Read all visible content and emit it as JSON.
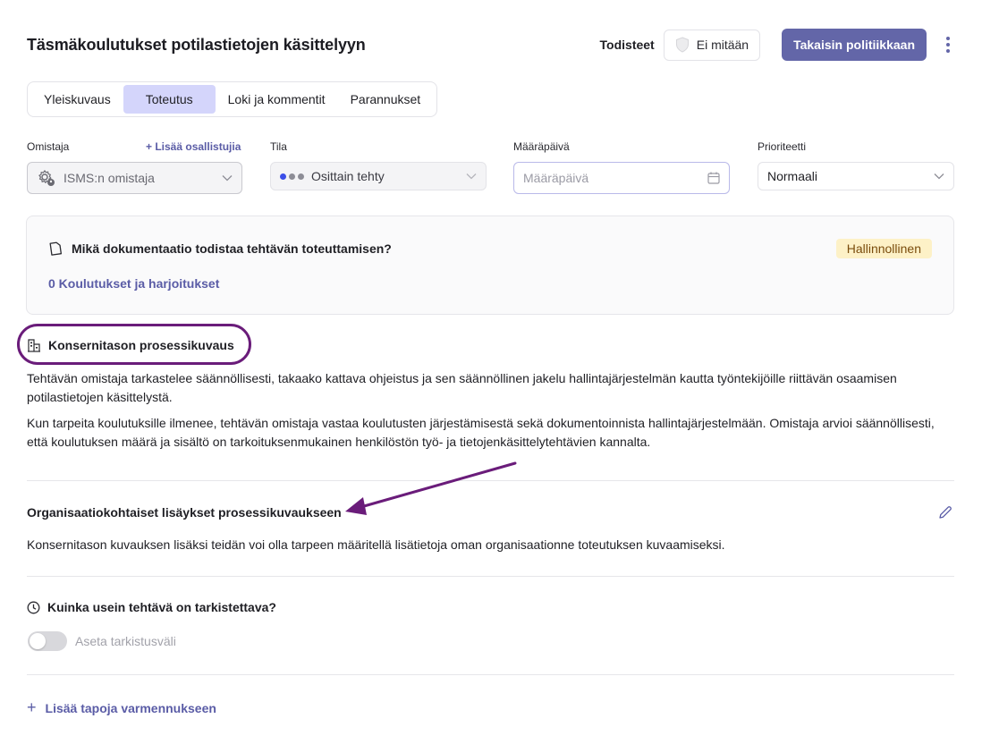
{
  "header": {
    "title": "Täsmäkoulutukset potilastietojen käsittelyyn",
    "evidence_label": "Todisteet",
    "evidence_value": "Ei mitään",
    "back_button": "Takaisin politiikkaan"
  },
  "tabs": [
    {
      "label": "Yleiskuvaus",
      "active": false
    },
    {
      "label": "Toteutus",
      "active": true
    },
    {
      "label": "Loki ja kommentit",
      "active": false
    },
    {
      "label": "Parannukset",
      "active": false
    }
  ],
  "fields": {
    "owner": {
      "label": "Omistaja",
      "add_link": "+ Lisää osallistujia",
      "value": "ISMS:n omistaja"
    },
    "status": {
      "label": "Tila",
      "value": "Osittain tehty",
      "dot_colors": [
        "#3b4ee8",
        "#8d8d96",
        "#8d8d96"
      ]
    },
    "due_date": {
      "label": "Määräpäivä",
      "placeholder": "Määräpäivä"
    },
    "priority": {
      "label": "Prioriteetti",
      "value": "Normaali"
    }
  },
  "documentation": {
    "question": "Mikä dokumentaatio todistaa tehtävän toteuttamisen?",
    "badge": "Hallinnollinen",
    "link": "0 Koulutukset ja harjoitukset"
  },
  "group_process": {
    "title": "Konsernitason prosessikuvaus",
    "paragraph1": "Tehtävän omistaja tarkastelee säännöllisesti, takaako kattava ohjeistus ja sen säännöllinen jakelu hallintajärjestelmän kautta työntekijöille riittävän osaamisen potilastietojen käsittelystä.",
    "paragraph2": "Kun tarpeita koulutuksille ilmenee, tehtävän omistaja vastaa koulutusten järjestämisestä sekä dokumentoinnista hallintajärjestelmään. Omistaja arvioi säännöllisesti, että koulutuksen määrä ja sisältö on tarkoituksenmukainen henkilöstön työ- ja tietojenkäsittelytehtävien kannalta."
  },
  "org_additions": {
    "title": "Organisaatiokohtaiset lisäykset prosessikuvaukseen",
    "text": "Konsernitason kuvauksen lisäksi teidän voi olla tarpeen määritellä lisätietoja oman organisaationne toteutuksen kuvaamiseksi."
  },
  "review": {
    "title": "Kuinka usein tehtävä on tarkistettava?",
    "toggle_label": "Aseta tarkistusväli",
    "toggle_on": false
  },
  "add_methods": "Lisää tapoja varmennukseen",
  "colors": {
    "accent": "#6366a8",
    "annotation": "#6a1c7a",
    "badge_bg": "#fdf1c7"
  }
}
